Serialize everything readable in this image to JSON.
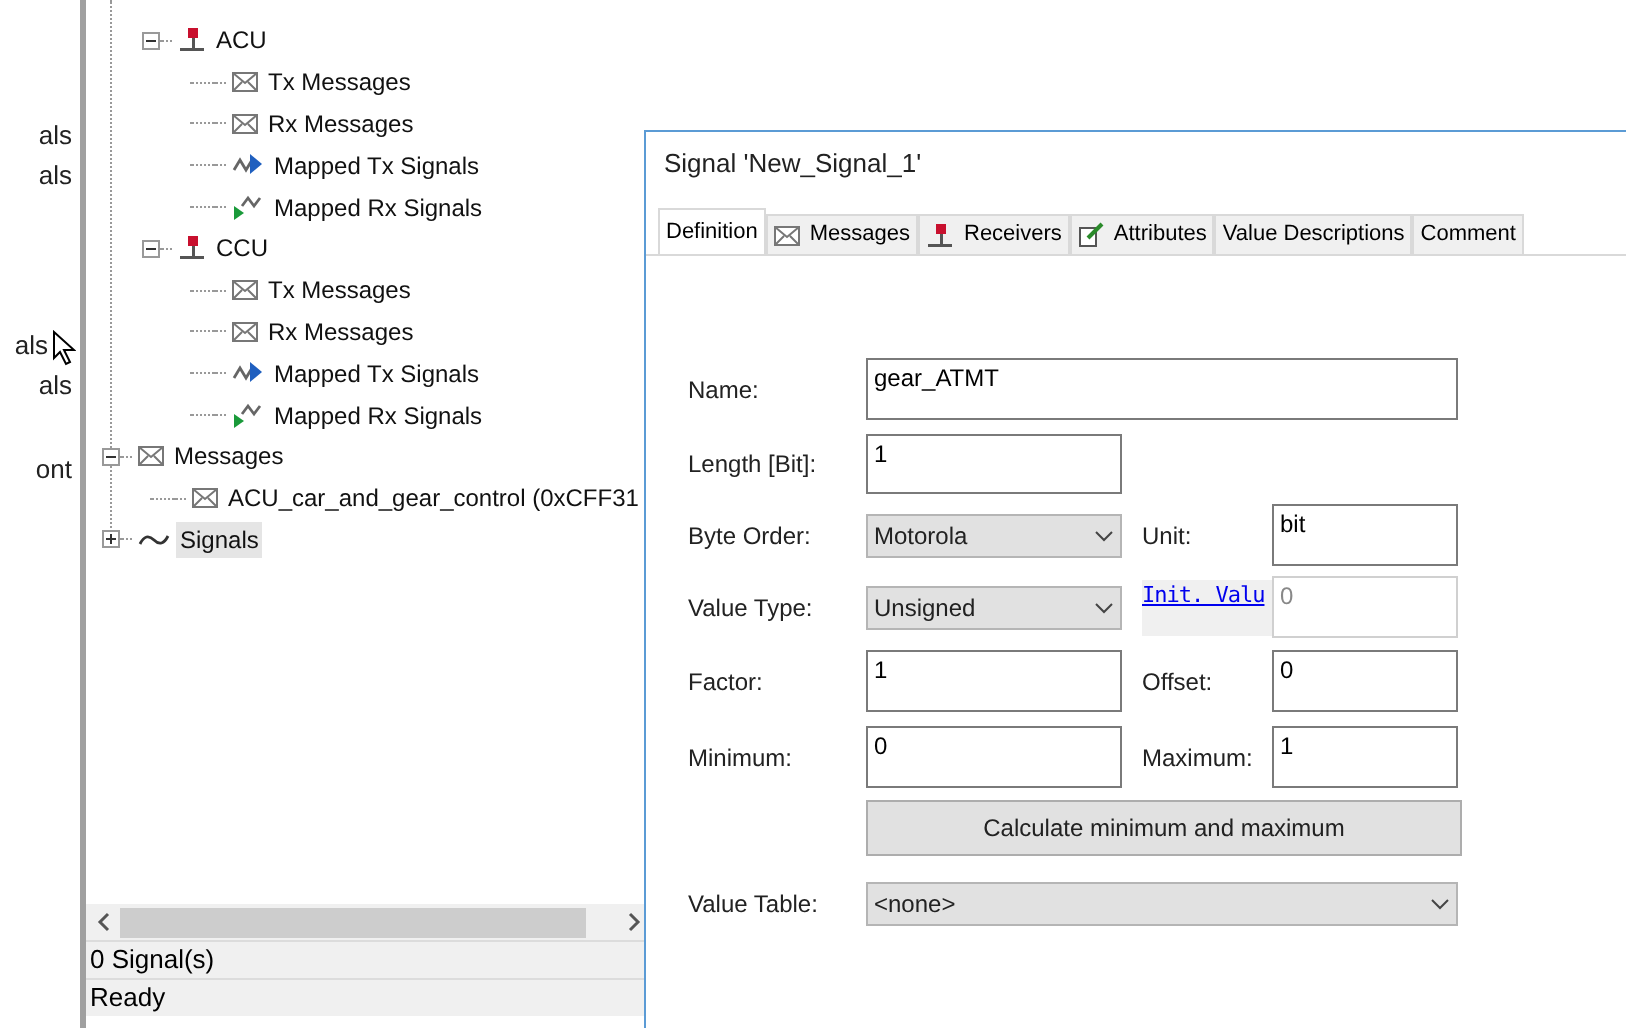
{
  "left_strip": {
    "texts": [
      "als",
      "als",
      "als",
      "als",
      "ont"
    ]
  },
  "tree": {
    "ecus": [
      {
        "label": "ACU",
        "kind": "ecu",
        "expanded": true,
        "children": [
          {
            "label": "Tx Messages",
            "kind": "message"
          },
          {
            "label": "Rx Messages",
            "kind": "message"
          },
          {
            "label": "Mapped Tx Signals",
            "kind": "mapped_tx"
          },
          {
            "label": "Mapped Rx Signals",
            "kind": "mapped_rx"
          }
        ]
      },
      {
        "label": "CCU",
        "kind": "ecu",
        "expanded": true,
        "children": [
          {
            "label": "Tx Messages",
            "kind": "message"
          },
          {
            "label": "Rx Messages",
            "kind": "message"
          },
          {
            "label": "Mapped Tx Signals",
            "kind": "mapped_tx"
          },
          {
            "label": "Mapped Rx Signals",
            "kind": "mapped_rx"
          }
        ]
      }
    ],
    "sections": [
      {
        "label": "Messages",
        "kind": "message",
        "expanded": true,
        "selected": false,
        "children": [
          {
            "label": "ACU_car_and_gear_control (0xCFF31",
            "kind": "message"
          }
        ]
      },
      {
        "label": "Signals",
        "kind": "signal",
        "expanded": false,
        "selected": true
      }
    ]
  },
  "status_bar": [
    "0 Signal(s)",
    "Ready"
  ],
  "dialog": {
    "title": "Signal 'New_Signal_1'",
    "tabs": [
      {
        "label": "Definition",
        "kind": "none",
        "selected": true
      },
      {
        "label": "Messages",
        "kind": "message",
        "selected": false
      },
      {
        "label": "Receivers",
        "kind": "ecu",
        "selected": false
      },
      {
        "label": "Attributes",
        "kind": "attributes",
        "selected": false
      },
      {
        "label": "Value Descriptions",
        "kind": "none",
        "selected": false
      },
      {
        "label": "Comment",
        "kind": "none",
        "selected": false
      }
    ],
    "name": {
      "label": "Name:",
      "value": "gear_ATMT"
    },
    "length": {
      "label": "Length [Bit]:",
      "value": "1"
    },
    "byte_order": {
      "label": "Byte Order:",
      "value": "Motorola"
    },
    "unit": {
      "label": "Unit:",
      "value": "bit"
    },
    "value_type": {
      "label": "Value Type:",
      "value": "Unsigned"
    },
    "init_value": {
      "label": "Init. Valu",
      "value": "0",
      "disabled": true
    },
    "factor": {
      "label": "Factor:",
      "value": "1"
    },
    "offset": {
      "label": "Offset:",
      "value": "0"
    },
    "minimum": {
      "label": "Minimum:",
      "value": "0"
    },
    "maximum": {
      "label": "Maximum:",
      "value": "1"
    },
    "calculate_button": "Calculate minimum and maximum",
    "value_table": {
      "label": "Value Table:",
      "value": "<none>"
    }
  }
}
